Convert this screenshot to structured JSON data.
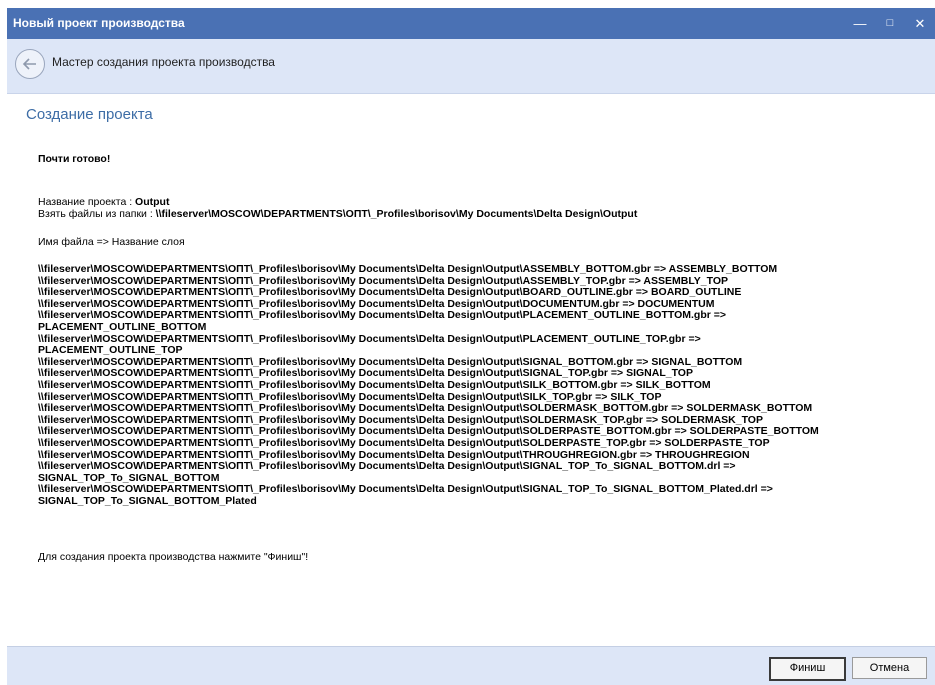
{
  "window": {
    "title": "Новый проект производства",
    "controls": {
      "minimize": "—",
      "maximize": "□",
      "close": "✕"
    }
  },
  "wizard": {
    "header_title": "Мастер создания проекта производства",
    "page_title": "Создание проекта"
  },
  "content": {
    "almost_ready": "Почти готово!",
    "project_name_label": "Название проекта : ",
    "project_name_value": "Output",
    "source_folder_label": "Взять файлы из папки : ",
    "source_folder_value": "\\\\fileserver\\MOSCOW\\DEPARTMENTS\\ОПТ\\_Profiles\\borisov\\My Documents\\Delta Design\\Output",
    "mapping_heading": "Имя файла => Название слоя",
    "mappings": [
      "\\\\fileserver\\MOSCOW\\DEPARTMENTS\\ОПТ\\_Profiles\\borisov\\My Documents\\Delta Design\\Output\\ASSEMBLY_BOTTOM.gbr => ASSEMBLY_BOTTOM",
      "\\\\fileserver\\MOSCOW\\DEPARTMENTS\\ОПТ\\_Profiles\\borisov\\My Documents\\Delta Design\\Output\\ASSEMBLY_TOP.gbr => ASSEMBLY_TOP",
      "\\\\fileserver\\MOSCOW\\DEPARTMENTS\\ОПТ\\_Profiles\\borisov\\My Documents\\Delta Design\\Output\\BOARD_OUTLINE.gbr => BOARD_OUTLINE",
      "\\\\fileserver\\MOSCOW\\DEPARTMENTS\\ОПТ\\_Profiles\\borisov\\My Documents\\Delta Design\\Output\\DOCUMENTUM.gbr => DOCUMENTUM",
      "\\\\fileserver\\MOSCOW\\DEPARTMENTS\\ОПТ\\_Profiles\\borisov\\My Documents\\Delta Design\\Output\\PLACEMENT_OUTLINE_BOTTOM.gbr =>\nPLACEMENT_OUTLINE_BOTTOM",
      "\\\\fileserver\\MOSCOW\\DEPARTMENTS\\ОПТ\\_Profiles\\borisov\\My Documents\\Delta Design\\Output\\PLACEMENT_OUTLINE_TOP.gbr =>\nPLACEMENT_OUTLINE_TOP",
      "\\\\fileserver\\MOSCOW\\DEPARTMENTS\\ОПТ\\_Profiles\\borisov\\My Documents\\Delta Design\\Output\\SIGNAL_BOTTOM.gbr => SIGNAL_BOTTOM",
      "\\\\fileserver\\MOSCOW\\DEPARTMENTS\\ОПТ\\_Profiles\\borisov\\My Documents\\Delta Design\\Output\\SIGNAL_TOP.gbr => SIGNAL_TOP",
      "\\\\fileserver\\MOSCOW\\DEPARTMENTS\\ОПТ\\_Profiles\\borisov\\My Documents\\Delta Design\\Output\\SILK_BOTTOM.gbr => SILK_BOTTOM",
      "\\\\fileserver\\MOSCOW\\DEPARTMENTS\\ОПТ\\_Profiles\\borisov\\My Documents\\Delta Design\\Output\\SILK_TOP.gbr => SILK_TOP",
      "\\\\fileserver\\MOSCOW\\DEPARTMENTS\\ОПТ\\_Profiles\\borisov\\My Documents\\Delta Design\\Output\\SOLDERMASK_BOTTOM.gbr => SOLDERMASK_BOTTOM",
      "\\\\fileserver\\MOSCOW\\DEPARTMENTS\\ОПТ\\_Profiles\\borisov\\My Documents\\Delta Design\\Output\\SOLDERMASK_TOP.gbr => SOLDERMASK_TOP",
      "\\\\fileserver\\MOSCOW\\DEPARTMENTS\\ОПТ\\_Profiles\\borisov\\My Documents\\Delta Design\\Output\\SOLDERPASTE_BOTTOM.gbr => SOLDERPASTE_BOTTOM",
      "\\\\fileserver\\MOSCOW\\DEPARTMENTS\\ОПТ\\_Profiles\\borisov\\My Documents\\Delta Design\\Output\\SOLDERPASTE_TOP.gbr => SOLDERPASTE_TOP",
      "\\\\fileserver\\MOSCOW\\DEPARTMENTS\\ОПТ\\_Profiles\\borisov\\My Documents\\Delta Design\\Output\\THROUGHREGION.gbr => THROUGHREGION",
      "\\\\fileserver\\MOSCOW\\DEPARTMENTS\\ОПТ\\_Profiles\\borisov\\My Documents\\Delta Design\\Output\\SIGNAL_TOP_To_SIGNAL_BOTTOM.drl =>\nSIGNAL_TOP_To_SIGNAL_BOTTOM",
      "\\\\fileserver\\MOSCOW\\DEPARTMENTS\\ОПТ\\_Profiles\\borisov\\My Documents\\Delta Design\\Output\\SIGNAL_TOP_To_SIGNAL_BOTTOM_Plated.drl =>\nSIGNAL_TOP_To_SIGNAL_BOTTOM_Plated"
    ],
    "finish_hint": "Для создания проекта производства нажмите \"Финиш\"!"
  },
  "footer": {
    "finish_label": "Финиш",
    "cancel_label": "Отмена"
  },
  "colors": {
    "titlebar": "#4a71b4",
    "header_bg": "#dde6f7",
    "page_title": "#3d6da6"
  }
}
